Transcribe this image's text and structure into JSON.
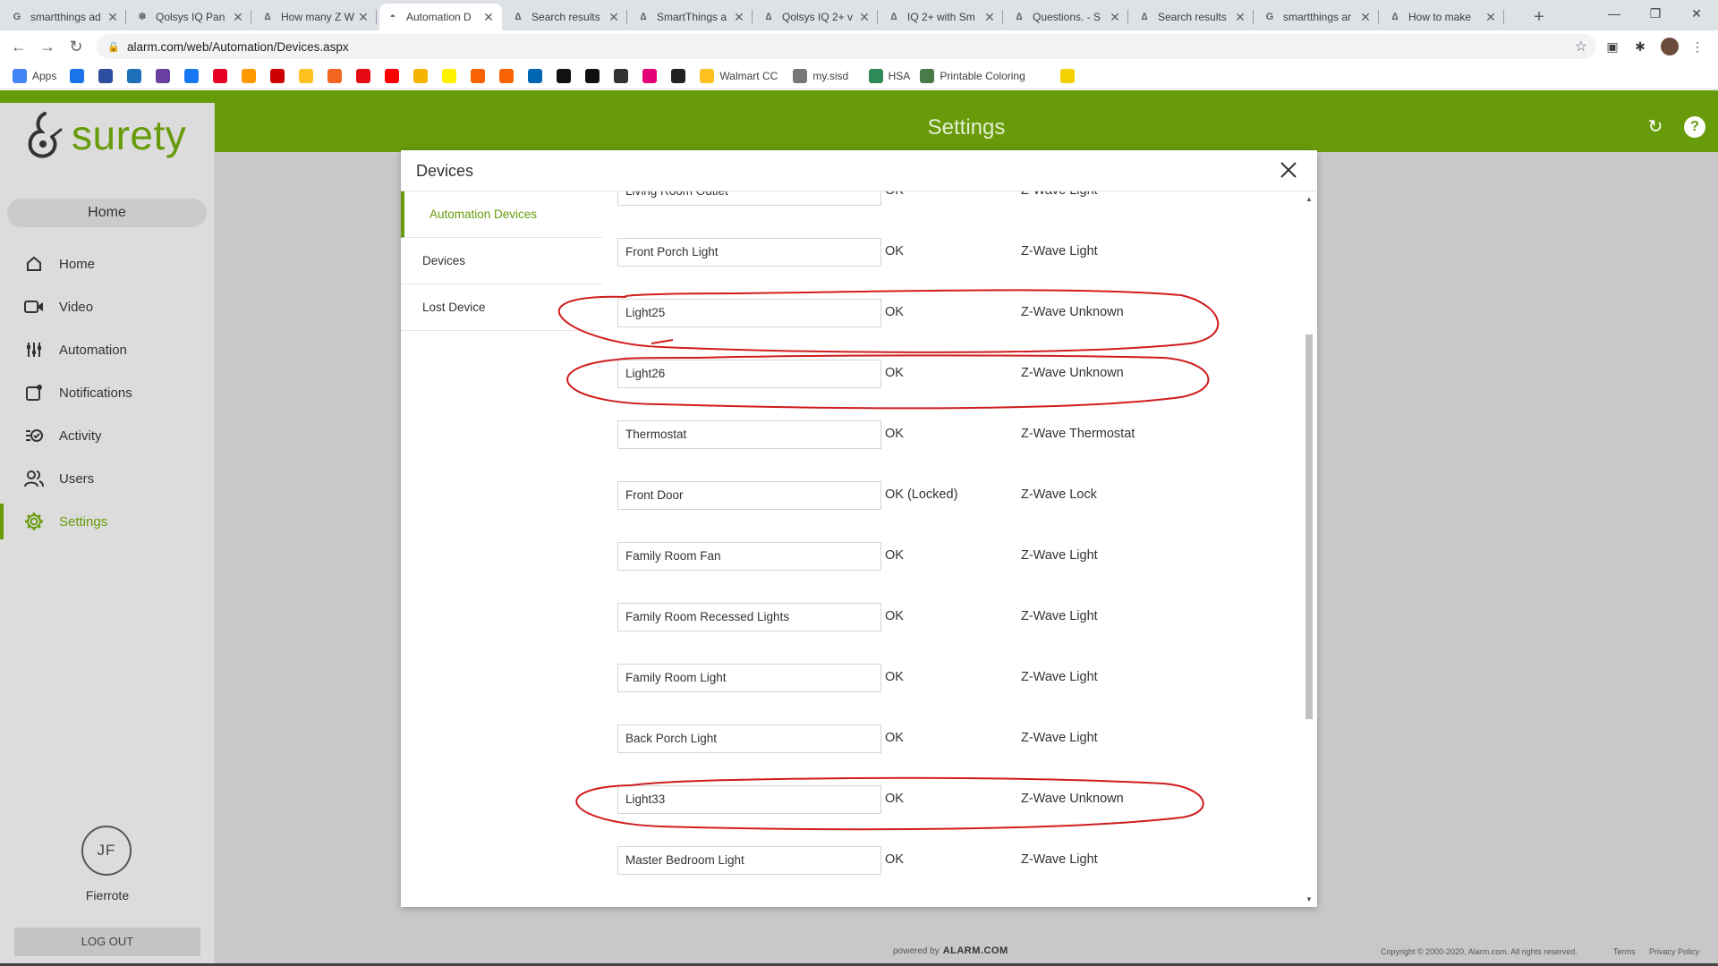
{
  "browser": {
    "tabs": [
      {
        "title": "smartthings ad",
        "icon": "google-icon"
      },
      {
        "title": "Qolsys IQ Pan",
        "icon": "snowflake-icon"
      },
      {
        "title": "How many Z W",
        "icon": "smartthings-icon"
      },
      {
        "title": "Automation D",
        "icon": "alarm-icon"
      },
      {
        "title": "Search results",
        "icon": "smartthings-icon"
      },
      {
        "title": "SmartThings a",
        "icon": "smartthings-icon"
      },
      {
        "title": "Qolsys IQ 2+ v",
        "icon": "smartthings-icon"
      },
      {
        "title": "IQ 2+ with Sm",
        "icon": "smartthings-icon"
      },
      {
        "title": "Questions. - S",
        "icon": "smartthings-icon"
      },
      {
        "title": "Search results",
        "icon": "smartthings-icon"
      },
      {
        "title": "smartthings ar",
        "icon": "google-icon"
      },
      {
        "title": "How to make",
        "icon": "smartthings-icon"
      }
    ],
    "url": "alarm.com/web/Automation/Devices.aspx",
    "bookmarks": [
      {
        "label": "Apps",
        "color": "#4285f4"
      },
      {
        "label": "",
        "color": "#1a73e8"
      },
      {
        "label": "",
        "color": "#2b4f9e"
      },
      {
        "label": "",
        "color": "#1d6fb8"
      },
      {
        "label": "",
        "color": "#6b3fa0"
      },
      {
        "label": "",
        "color": "#1877f2"
      },
      {
        "label": "",
        "color": "#e60023"
      },
      {
        "label": "",
        "color": "#ff9900"
      },
      {
        "label": "",
        "color": "#cc0000"
      },
      {
        "label": "",
        "color": "#ffc220"
      },
      {
        "label": "",
        "color": "#f26522"
      },
      {
        "label": "",
        "color": "#e50914"
      },
      {
        "label": "",
        "color": "#ff0000"
      },
      {
        "label": "",
        "color": "#f4b400"
      },
      {
        "label": "",
        "color": "#fff200"
      },
      {
        "label": "",
        "color": "#f96302"
      },
      {
        "label": "",
        "color": "#f96302"
      },
      {
        "label": "",
        "color": "#0066b2"
      },
      {
        "label": "",
        "color": "#111111"
      },
      {
        "label": "",
        "color": "#111111"
      },
      {
        "label": "",
        "color": "#333333"
      },
      {
        "label": "",
        "color": "#e20074"
      },
      {
        "label": "",
        "color": "#222222"
      },
      {
        "label": "Walmart CC",
        "color": "#ffc220"
      },
      {
        "label": "my.sisd",
        "color": "#777777"
      },
      {
        "label": "HSA",
        "color": "#2e8b57"
      },
      {
        "label": "Printable Coloring",
        "color": "#4a7a4a"
      },
      {
        "label": "",
        "color": "#f5d000"
      }
    ]
  },
  "app": {
    "brand": "surety",
    "header_title": "Settings",
    "sidebar": {
      "home_pill": "Home",
      "items": [
        {
          "label": "Home",
          "icon": "house-icon",
          "active": false
        },
        {
          "label": "Video",
          "icon": "video-camera-icon",
          "active": false
        },
        {
          "label": "Automation",
          "icon": "sliders-icon",
          "active": false
        },
        {
          "label": "Notifications",
          "icon": "bell-square-icon",
          "active": false
        },
        {
          "label": "Activity",
          "icon": "activity-list-icon",
          "active": false
        },
        {
          "label": "Users",
          "icon": "users-icon",
          "active": false
        },
        {
          "label": "Settings",
          "icon": "gear-icon",
          "active": true
        }
      ],
      "user_initials": "JF",
      "user_name": "Fierrote",
      "logout": "LOG OUT"
    },
    "modal": {
      "title": "Devices",
      "nav": [
        {
          "label": "Automation Devices",
          "active": true
        },
        {
          "label": "Devices",
          "active": false
        },
        {
          "label": "Lost Device",
          "active": false
        }
      ],
      "devices": [
        {
          "name": "Living Room Outlet",
          "status": "OK",
          "type": "Z-Wave Light"
        },
        {
          "name": "Front Porch Light",
          "status": "OK",
          "type": "Z-Wave Light"
        },
        {
          "name": "Light25",
          "status": "OK",
          "type": "Z-Wave Unknown"
        },
        {
          "name": "Light26",
          "status": "OK",
          "type": "Z-Wave Unknown"
        },
        {
          "name": "Thermostat",
          "status": "OK",
          "type": "Z-Wave Thermostat"
        },
        {
          "name": "Front Door",
          "status": "OK (Locked)",
          "type": "Z-Wave Lock"
        },
        {
          "name": "Family Room Fan",
          "status": "OK",
          "type": "Z-Wave Light"
        },
        {
          "name": "Family Room Recessed Lights",
          "status": "OK",
          "type": "Z-Wave Light"
        },
        {
          "name": "Family Room Light",
          "status": "OK",
          "type": "Z-Wave Light"
        },
        {
          "name": "Back Porch Light",
          "status": "OK",
          "type": "Z-Wave Light"
        },
        {
          "name": "Light33",
          "status": "OK",
          "type": "Z-Wave Unknown"
        },
        {
          "name": "Master Bedroom Light",
          "status": "OK",
          "type": "Z-Wave Light"
        }
      ]
    },
    "footer": {
      "powered_by": "powered by",
      "powered_brand": "ALARM.COM",
      "copyright": "Copyright © 2000-2020, Alarm.com. All rights reserved.",
      "terms": "Terms",
      "privacy": "Privacy Policy"
    },
    "colors": {
      "accent": "#689b0a",
      "annotation": "#d01c1c"
    }
  }
}
